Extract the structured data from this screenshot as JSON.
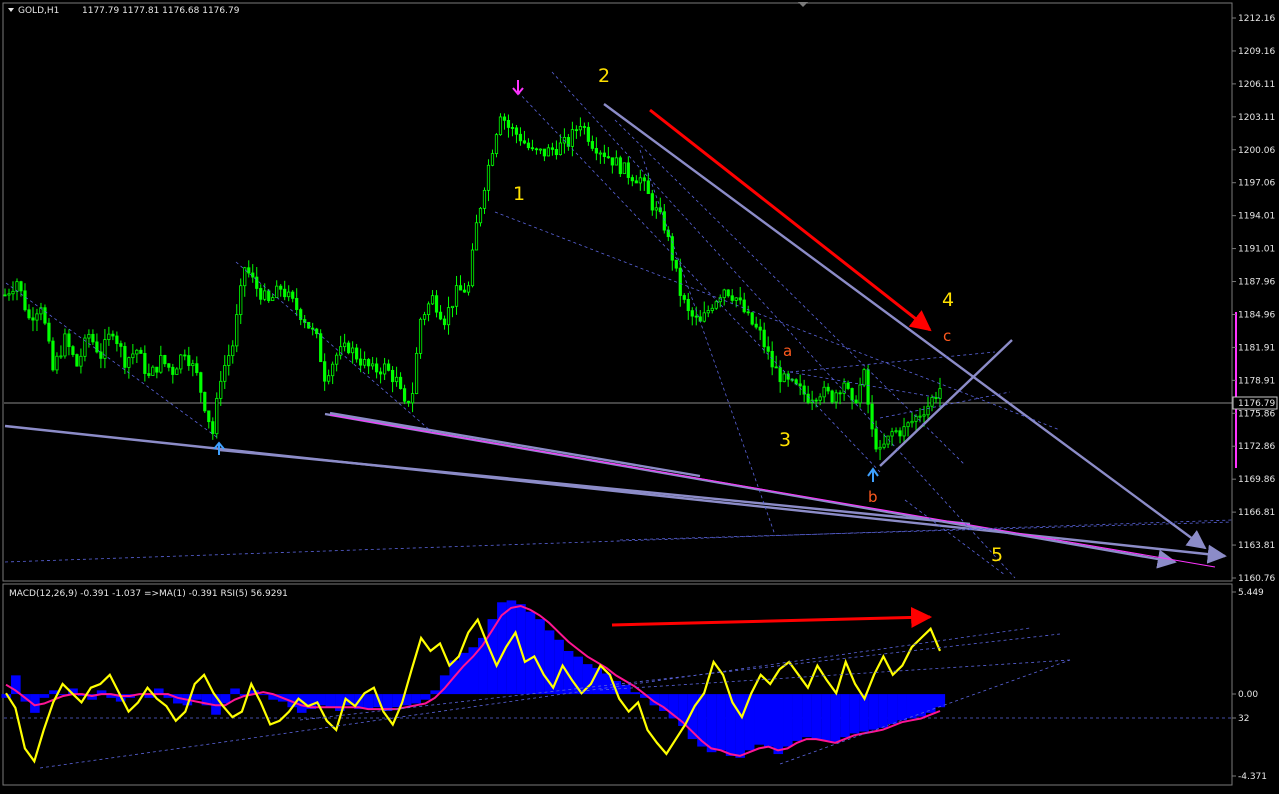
{
  "colors": {
    "background": "#000000",
    "candle": "#00ff00",
    "trendline": "#8c8cc8",
    "dashed": "#5a64dc",
    "arrow_red": "#ff0000",
    "wave_label": "#ffe000",
    "subwave_label": "#ff5a1e",
    "macd_hist": "#0000ff",
    "macd_ma": "#ff1493",
    "rsi": "#ffff00"
  },
  "chart_data": [
    {
      "type": "candlestick",
      "title": "GOLD,H1",
      "header_values": "1177.79 1177.81 1176.68 1176.79",
      "ylim": [
        1159.5,
        1213.5
      ],
      "y_ticks": [
        "1212.16",
        "1209.16",
        "1206.11",
        "1203.11",
        "1200.06",
        "1197.06",
        "1194.01",
        "1191.01",
        "1187.96",
        "1184.96",
        "1181.91",
        "1178.91",
        "1175.86",
        "1172.86",
        "1169.86",
        "1166.81",
        "1163.81",
        "1160.76"
      ],
      "current_price": "1176.79",
      "price_path": [
        [
          0,
          1186.8
        ],
        [
          3,
          1188.2
        ],
        [
          6,
          1184.5
        ],
        [
          9,
          1186.0
        ],
        [
          12,
          1179.5
        ],
        [
          15,
          1182.5
        ],
        [
          18,
          1180.0
        ],
        [
          21,
          1183.0
        ],
        [
          24,
          1181.0
        ],
        [
          27,
          1183.5
        ],
        [
          30,
          1180.5
        ],
        [
          33,
          1181.5
        ],
        [
          36,
          1178.8
        ],
        [
          39,
          1180.5
        ],
        [
          42,
          1179.5
        ],
        [
          45,
          1181.5
        ],
        [
          48,
          1179.0
        ],
        [
          50,
          1176.2
        ],
        [
          52,
          1173.5
        ],
        [
          54,
          1179.0
        ],
        [
          57,
          1182.0
        ],
        [
          60,
          1189.5
        ],
        [
          63,
          1187.5
        ],
        [
          66,
          1186.0
        ],
        [
          69,
          1187.5
        ],
        [
          72,
          1186.0
        ],
        [
          75,
          1184.5
        ],
        [
          78,
          1182.5
        ],
        [
          80,
          1179.0
        ],
        [
          83,
          1181.0
        ],
        [
          86,
          1181.8
        ],
        [
          89,
          1180.5
        ],
        [
          92,
          1179.5
        ],
        [
          95,
          1179.8
        ],
        [
          98,
          1178.5
        ],
        [
          100,
          1176.0
        ],
        [
          102,
          1177.5
        ],
        [
          104,
          1184.5
        ],
        [
          107,
          1186.5
        ],
        [
          110,
          1184.5
        ],
        [
          113,
          1187.0
        ],
        [
          116,
          1187.5
        ],
        [
          118,
          1193.5
        ],
        [
          120,
          1197.5
        ],
        [
          122,
          1201.0
        ],
        [
          124,
          1204.5
        ],
        [
          126,
          1203.0
        ],
        [
          129,
          1202.0
        ],
        [
          132,
          1200.5
        ],
        [
          135,
          1200.5
        ],
        [
          138,
          1201.0
        ],
        [
          141,
          1201.5
        ],
        [
          144,
          1203.5
        ],
        [
          147,
          1201.5
        ],
        [
          150,
          1200.5
        ],
        [
          153,
          1199.5
        ],
        [
          156,
          1198.5
        ],
        [
          159,
          1198.0
        ],
        [
          162,
          1195.5
        ],
        [
          165,
          1193.5
        ],
        [
          167,
          1190.5
        ],
        [
          169,
          1187.0
        ],
        [
          171,
          1185.0
        ],
        [
          174,
          1184.0
        ],
        [
          177,
          1186.0
        ],
        [
          180,
          1187.5
        ],
        [
          183,
          1186.5
        ],
        [
          186,
          1184.5
        ],
        [
          189,
          1183.0
        ],
        [
          192,
          1180.0
        ],
        [
          195,
          1178.5
        ],
        [
          198,
          1177.8
        ],
        [
          201,
          1177.0
        ],
        [
          204,
          1177.5
        ],
        [
          207,
          1177.0
        ],
        [
          210,
          1178.5
        ],
        [
          212,
          1176.0
        ],
        [
          215,
          1179.0
        ],
        [
          217,
          1173.5
        ],
        [
          219,
          1171.5
        ],
        [
          222,
          1173.5
        ],
        [
          225,
          1173.8
        ],
        [
          228,
          1175.0
        ],
        [
          231,
          1176.2
        ],
        [
          234,
          1177.8
        ]
      ],
      "wave_labels": [
        "1",
        "2",
        "3",
        "4",
        "5"
      ],
      "subwave_labels": [
        "a",
        "b",
        "c"
      ]
    },
    {
      "type": "line",
      "title": "MACD(12,26,9) -0.391 -1.037  =>MA(1) -0.391  RSI(5) 56.9291",
      "ylim": [
        -4.371,
        5.449
      ],
      "y_ticks": [
        "5.449",
        "0.00",
        "32",
        "-4.371"
      ],
      "series": [
        {
          "name": "MACD(12,26,9)",
          "values": [
            -0.2,
            1.0,
            -0.4,
            -1.0,
            -0.2,
            0.2,
            0.0,
            0.3,
            -0.1,
            -0.3,
            0.2,
            -0.2,
            -0.4,
            -0.2,
            0.0,
            -0.2,
            0.3,
            -0.2,
            -0.5,
            -0.6,
            -0.3,
            -0.6,
            -1.1,
            -0.5,
            0.3,
            -0.1,
            0.2,
            0.0,
            -0.3,
            -0.4,
            -0.7,
            -1.0,
            -0.8,
            -0.6,
            -0.7,
            -0.9,
            -0.6,
            -0.8,
            -0.8,
            -0.7,
            -0.9,
            -0.7,
            -0.6,
            -0.5,
            -0.3,
            0.2,
            1.0,
            1.8,
            2.2,
            2.5,
            3.0,
            4.0,
            4.9,
            5.0,
            4.8,
            4.4,
            4.0,
            3.4,
            2.9,
            2.3,
            2.0,
            1.6,
            1.4,
            1.1,
            0.7,
            0.5,
            0.1,
            -0.2,
            -0.6,
            -0.9,
            -1.3,
            -1.7,
            -2.4,
            -2.8,
            -3.1,
            -3.0,
            -3.3,
            -3.4,
            -3.0,
            -2.7,
            -2.8,
            -3.2,
            -2.8,
            -2.5,
            -2.3,
            -2.4,
            -2.5,
            -2.6,
            -2.3,
            -2.1,
            -2.0,
            -1.9,
            -1.8,
            -1.6,
            -1.4,
            -1.3,
            -1.2,
            -1.0,
            -0.7
          ],
          "ma_values": [
            0.5,
            0.2,
            -0.2,
            -0.6,
            -0.5,
            -0.3,
            -0.1,
            0.0,
            0.0,
            -0.1,
            0.0,
            0.0,
            -0.1,
            -0.1,
            0.0,
            0.0,
            0.0,
            0.0,
            -0.2,
            -0.3,
            -0.4,
            -0.5,
            -0.6,
            -0.6,
            -0.3,
            -0.1,
            0.0,
            0.1,
            0.0,
            -0.2,
            -0.4,
            -0.6,
            -0.7,
            -0.7,
            -0.7,
            -0.7,
            -0.7,
            -0.7,
            -0.8,
            -0.8,
            -0.8,
            -0.8,
            -0.7,
            -0.6,
            -0.5,
            -0.2,
            0.3,
            0.9,
            1.5,
            2.0,
            2.6,
            3.4,
            4.2,
            4.6,
            4.7,
            4.5,
            4.2,
            3.8,
            3.3,
            2.8,
            2.4,
            2.0,
            1.7,
            1.4,
            1.0,
            0.7,
            0.4,
            0.0,
            -0.4,
            -0.7,
            -1.1,
            -1.5,
            -2.0,
            -2.5,
            -2.9,
            -3.0,
            -3.2,
            -3.3,
            -3.1,
            -2.9,
            -2.8,
            -3.0,
            -2.9,
            -2.6,
            -2.4,
            -2.4,
            -2.5,
            -2.6,
            -2.4,
            -2.2,
            -2.1,
            -2.0,
            -1.9,
            -1.7,
            -1.5,
            -1.4,
            -1.3,
            -1.1,
            -0.9
          ]
        },
        {
          "name": "RSI(5)",
          "values": [
            45,
            37,
            15,
            8,
            25,
            40,
            50,
            45,
            40,
            48,
            50,
            55,
            45,
            35,
            40,
            48,
            42,
            38,
            30,
            35,
            50,
            55,
            45,
            38,
            32,
            35,
            50,
            40,
            28,
            30,
            35,
            42,
            38,
            40,
            30,
            25,
            42,
            38,
            45,
            48,
            35,
            28,
            40,
            58,
            75,
            68,
            72,
            60,
            65,
            78,
            85,
            72,
            60,
            70,
            78,
            62,
            65,
            55,
            48,
            60,
            52,
            45,
            50,
            60,
            55,
            42,
            35,
            40,
            25,
            18,
            12,
            20,
            28,
            38,
            45,
            62,
            55,
            40,
            32,
            45,
            55,
            50,
            58,
            62,
            55,
            48,
            60,
            52,
            45,
            62,
            50,
            42,
            55,
            65,
            55,
            60,
            70,
            75,
            80,
            68
          ]
        }
      ]
    }
  ]
}
